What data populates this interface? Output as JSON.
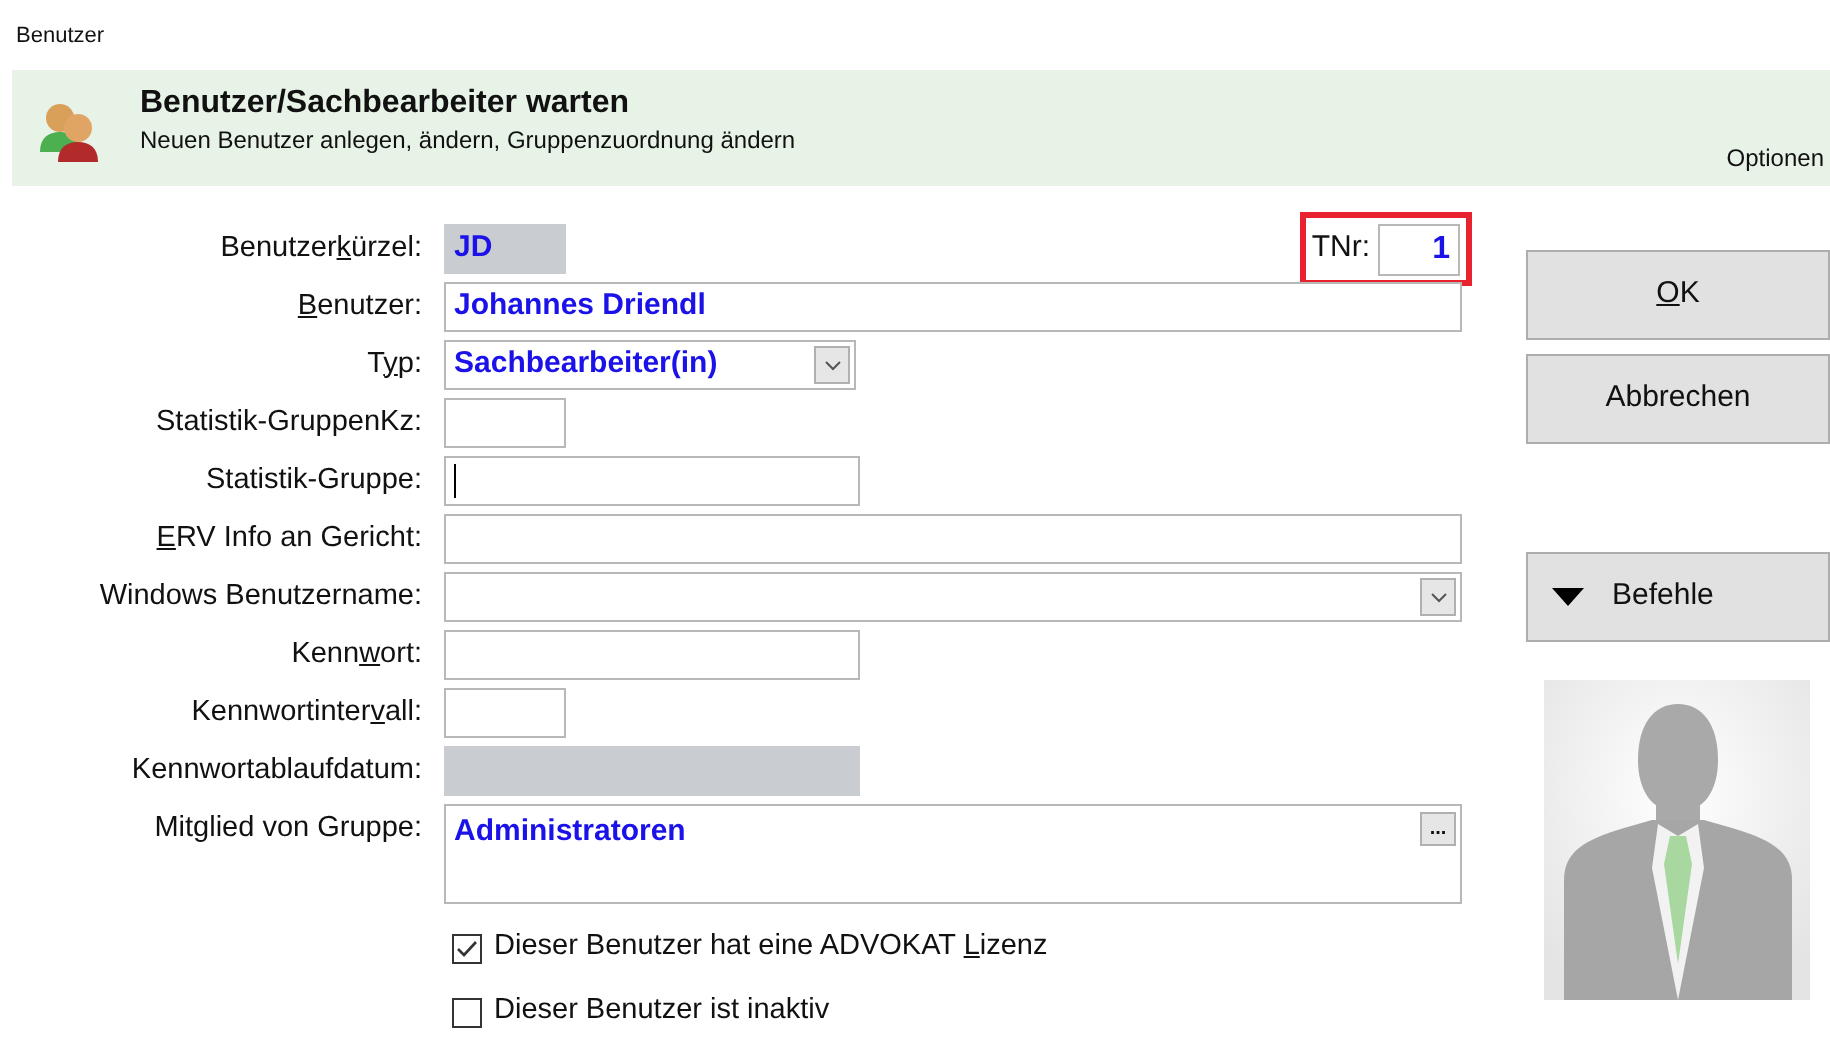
{
  "window": {
    "title": "Benutzer"
  },
  "header": {
    "title": "Benutzer/Sachbearbeiter warten",
    "subtitle": "Neuen Benutzer anlegen, ändern, Gruppenzuordnung ändern",
    "options": "Optionen"
  },
  "tnr": {
    "label": "TNr:",
    "value": "1"
  },
  "fields": [
    {
      "kind": "text",
      "label": [
        {
          "text": "Benutzer",
          "underlined": false
        },
        {
          "text": "k",
          "underlined": true
        },
        {
          "text": "ürzel:",
          "underlined": false
        }
      ],
      "value": "JD",
      "readonly": true
    },
    {
      "kind": "text",
      "label": [
        {
          "text": "B",
          "underlined": true
        },
        {
          "text": "enutzer:",
          "underlined": false
        }
      ],
      "value": "Johannes Driendl"
    },
    {
      "kind": "select",
      "label": [
        {
          "text": "T",
          "underlined": false
        },
        {
          "text": "y",
          "underlined": true
        },
        {
          "text": "p:",
          "underlined": false
        }
      ],
      "value": "Sachbearbeiter(in)"
    },
    {
      "kind": "text",
      "label": [
        {
          "text": "Statistik-GruppenKz:",
          "underlined": false
        }
      ]
    },
    {
      "kind": "text",
      "label": [
        {
          "text": "Statistik-Gruppe:",
          "underlined": false
        }
      ],
      "focused": true
    },
    {
      "kind": "text",
      "label": [
        {
          "text": "E",
          "underlined": true
        },
        {
          "text": "RV Info an Gericht:",
          "underlined": false
        }
      ]
    },
    {
      "kind": "select",
      "label": [
        {
          "text": "Windows Benutzername:",
          "underlined": false
        }
      ]
    },
    {
      "kind": "text",
      "label": [
        {
          "text": "Kenn",
          "underlined": false
        },
        {
          "text": "w",
          "underlined": true
        },
        {
          "text": "ort:",
          "underlined": false
        }
      ]
    },
    {
      "kind": "text",
      "label": [
        {
          "text": "Kennwortinter",
          "underlined": false
        },
        {
          "text": "v",
          "underlined": true
        },
        {
          "text": "all:",
          "underlined": false
        }
      ]
    },
    {
      "kind": "text",
      "label": [
        {
          "text": "Kennwortablaufdatum:",
          "underlined": false
        }
      ],
      "readonly": true
    },
    {
      "kind": "multiline",
      "label": [
        {
          "text": "Mitglied von Gruppe:",
          "underlined": false
        }
      ],
      "value": "Administratoren",
      "button": "..."
    }
  ],
  "checkboxes": [
    {
      "label": [
        {
          "text": "Dieser Benutzer hat eine ADVOKAT ",
          "underlined": false
        },
        {
          "text": "L",
          "underlined": true
        },
        {
          "text": "izenz",
          "underlined": false
        }
      ],
      "checked": true
    },
    {
      "label": [
        {
          "text": "Dieser Benutzer ist inaktiv",
          "underlined": false
        }
      ],
      "checked": false
    }
  ],
  "buttons": [
    {
      "kind": "ok",
      "label": [
        {
          "text": "O",
          "underlined": true
        },
        {
          "text": "K",
          "underlined": false
        }
      ]
    },
    {
      "kind": "cancel",
      "label": [
        {
          "text": "Abbrechen",
          "underlined": false
        }
      ]
    },
    {
      "kind": "menu",
      "label": [
        {
          "text": "Befehle",
          "underlined": false
        }
      ]
    }
  ]
}
